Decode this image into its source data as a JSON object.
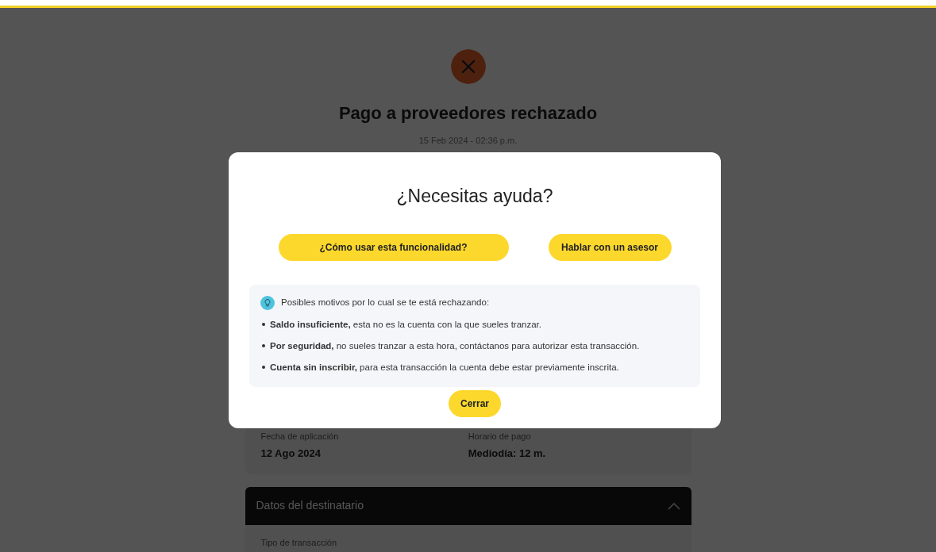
{
  "page": {
    "title": "Pago a proveedores rechazado",
    "date": "15 Feb 2024 - 02:36 p.m.",
    "summary_fields": [
      {
        "label": "Fecha de aplicación",
        "value": "12 Ago 2024"
      },
      {
        "label": "Horario de pago",
        "value": "Mediodía:  12 m."
      }
    ],
    "sections": [
      {
        "title": "Datos del destinatario",
        "expanded": true,
        "fields": [
          {
            "label": "Tipo de transacción"
          }
        ]
      }
    ]
  },
  "modal": {
    "title": "¿Necesitas ayuda?",
    "buttons": [
      {
        "label": "¿Cómo usar esta funcionalidad?",
        "kind": "wide"
      },
      {
        "label": "Hablar con un asesor",
        "kind": "compact"
      }
    ],
    "info": {
      "intro": "Posibles motivos por lo cual se te está rechazando:",
      "reasons": [
        "**Saldo insuficiente,** esta no es la cuenta con la que sueles tranzar.",
        "**Por seguridad,** no sueles tranzar a esta hora, contáctanos para autorizar esta transacción.",
        "**Cuenta sin inscribir,** para esta transacción la cuenta debe estar previamente inscrita."
      ]
    },
    "close_button": "Cerrar"
  }
}
